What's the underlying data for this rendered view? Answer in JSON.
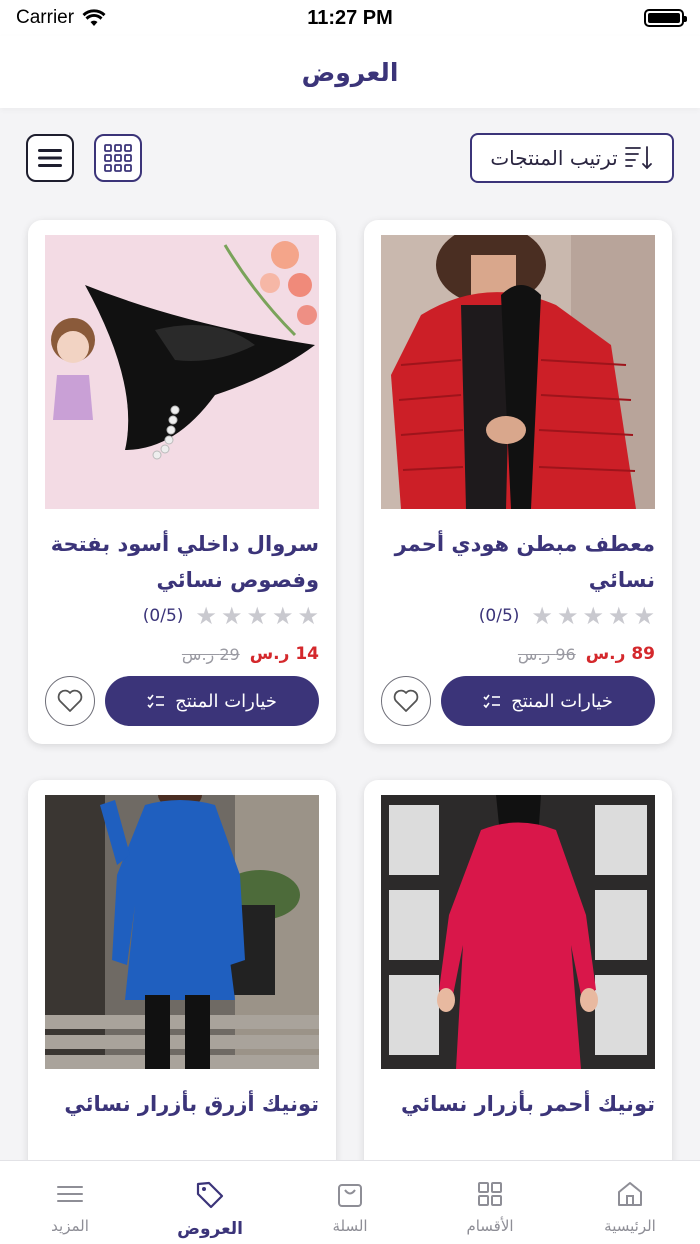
{
  "status": {
    "carrier": "Carrier",
    "time": "11:27 PM"
  },
  "header": {
    "title": "العروض"
  },
  "toolbar": {
    "sort_label": "ترتيب المنتجات"
  },
  "products": [
    {
      "title": "معطف مبطن هودي أحمر نسائي",
      "rating": "(0/5)",
      "price": "89 ر.س",
      "old_price": "96 ر.س",
      "options_label": "خيارات المنتج"
    },
    {
      "title": "سروال داخلي أسود بفتحة وفصوص نسائي",
      "rating": "(0/5)",
      "price": "14 ر.س",
      "old_price": "29 ر.س",
      "options_label": "خيارات المنتج"
    },
    {
      "title": "تونيك أحمر بأزرار نسائي"
    },
    {
      "title": "تونيك أزرق بأزرار نسائي"
    }
  ],
  "tabs": [
    {
      "label": "الرئيسية",
      "icon": "home-icon"
    },
    {
      "label": "الأقسام",
      "icon": "grid-icon"
    },
    {
      "label": "السلة",
      "icon": "bag-icon"
    },
    {
      "label": "العروض",
      "icon": "tag-icon",
      "active": true
    },
    {
      "label": "المزيد",
      "icon": "menu-icon"
    }
  ],
  "colors": {
    "primary": "#3b3479",
    "price": "#d4282c",
    "star": "#c9c9cf"
  }
}
